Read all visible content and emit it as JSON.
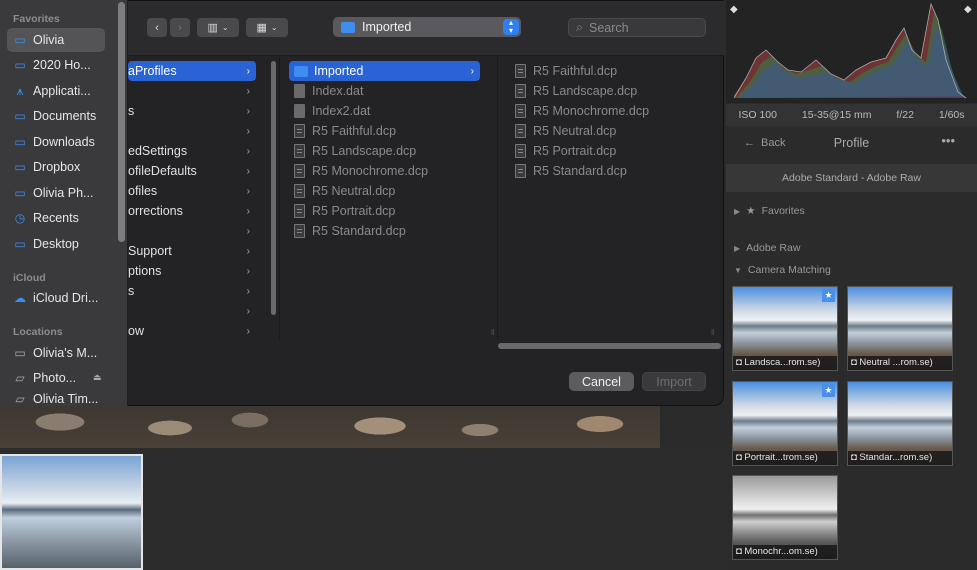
{
  "sidebar": {
    "sections": {
      "favorites": "Favorites",
      "icloud": "iCloud",
      "locations": "Locations"
    },
    "favorites": [
      {
        "label": "Olivia",
        "icon": "folder-icon",
        "selected": true
      },
      {
        "label": "2020 Ho...",
        "icon": "folder-icon"
      },
      {
        "label": "Applicati...",
        "icon": "applications-icon"
      },
      {
        "label": "Documents",
        "icon": "folder-icon"
      },
      {
        "label": "Downloads",
        "icon": "folder-icon"
      },
      {
        "label": "Dropbox",
        "icon": "folder-icon"
      },
      {
        "label": "Olivia Ph...",
        "icon": "folder-icon"
      },
      {
        "label": "Recents",
        "icon": "clock-icon"
      },
      {
        "label": "Desktop",
        "icon": "folder-icon"
      }
    ],
    "icloud": [
      {
        "label": "iCloud Dri...",
        "icon": "cloud-icon"
      }
    ],
    "locations": [
      {
        "label": "Olivia's M...",
        "icon": "laptop-icon"
      },
      {
        "label": "Photo...",
        "icon": "drive-icon"
      },
      {
        "label": "Olivia Tim...",
        "icon": "drive-icon"
      }
    ]
  },
  "toolbar": {
    "back": "‹",
    "forward": "›",
    "column_view": "▥",
    "group": "▦",
    "location": "Imported",
    "search_placeholder": "Search"
  },
  "columns": {
    "col1": [
      {
        "label": "aProfiles",
        "selected": true
      },
      {
        "label": ""
      },
      {
        "label": "s"
      },
      {
        "label": ""
      },
      {
        "label": "edSettings"
      },
      {
        "label": "ofileDefaults"
      },
      {
        "label": "ofiles"
      },
      {
        "label": "orrections"
      },
      {
        "label": ""
      },
      {
        "label": "Support"
      },
      {
        "label": "ptions"
      },
      {
        "label": "s"
      },
      {
        "label": ""
      },
      {
        "label": "ow"
      }
    ],
    "col2": [
      {
        "label": "Imported",
        "kind": "folder",
        "selected": true
      },
      {
        "label": "Index.dat",
        "kind": "plain"
      },
      {
        "label": "Index2.dat",
        "kind": "plain"
      },
      {
        "label": "R5  Faithful.dcp",
        "kind": "doc"
      },
      {
        "label": "R5  Landscape.dcp",
        "kind": "doc"
      },
      {
        "label": "R5  Monochrome.dcp",
        "kind": "doc"
      },
      {
        "label": "R5  Neutral.dcp",
        "kind": "doc"
      },
      {
        "label": "R5  Portrait.dcp",
        "kind": "doc"
      },
      {
        "label": "R5  Standard.dcp",
        "kind": "doc"
      }
    ],
    "col3": [
      {
        "label": "R5  Faithful.dcp"
      },
      {
        "label": "R5  Landscape.dcp"
      },
      {
        "label": "R5  Monochrome.dcp"
      },
      {
        "label": "R5  Neutral.dcp"
      },
      {
        "label": "R5  Portrait.dcp"
      },
      {
        "label": "R5  Standard.dcp"
      }
    ]
  },
  "dialog_buttons": {
    "cancel": "Cancel",
    "import": "Import"
  },
  "right_panel": {
    "camera_info": [
      "ISO 100",
      "15-35@15 mm",
      "f/22",
      "1/60s"
    ],
    "back": "Back",
    "title": "Profile",
    "more": "•••",
    "current_profile": "Adobe Standard - Adobe Raw",
    "groups": [
      {
        "label": "Favorites",
        "expanded": false,
        "star": true
      },
      {
        "label": "Adobe Raw",
        "expanded": false
      },
      {
        "label": "Camera Matching",
        "expanded": true
      }
    ],
    "thumbnails": [
      {
        "caption": "Landsca...rom.se)",
        "starred": true
      },
      {
        "caption": "Neutral ...rom.se)",
        "starred": false
      },
      {
        "caption": "Portrait...trom.se)",
        "starred": true
      },
      {
        "caption": "Standar...rom.se)",
        "starred": false
      },
      {
        "caption": "Monochr...om.se)",
        "starred": false,
        "mono": true
      }
    ]
  },
  "colors": {
    "accent": "#2a63d6",
    "folder": "#3d8ef0"
  }
}
